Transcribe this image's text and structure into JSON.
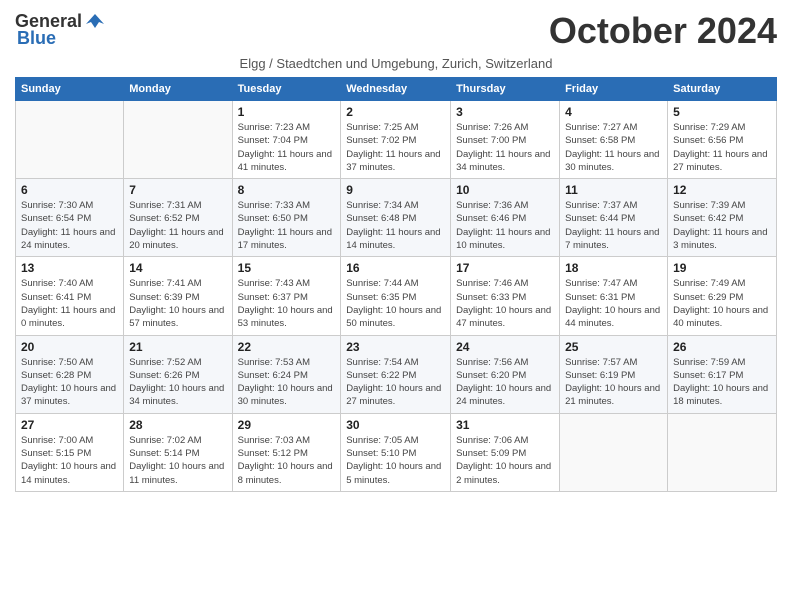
{
  "header": {
    "logo_general": "General",
    "logo_blue": "Blue",
    "month_title": "October 2024",
    "subtitle": "Elgg / Staedtchen und Umgebung, Zurich, Switzerland"
  },
  "weekdays": [
    "Sunday",
    "Monday",
    "Tuesday",
    "Wednesday",
    "Thursday",
    "Friday",
    "Saturday"
  ],
  "weeks": [
    [
      {
        "day": "",
        "info": ""
      },
      {
        "day": "",
        "info": ""
      },
      {
        "day": "1",
        "info": "Sunrise: 7:23 AM\nSunset: 7:04 PM\nDaylight: 11 hours and 41 minutes."
      },
      {
        "day": "2",
        "info": "Sunrise: 7:25 AM\nSunset: 7:02 PM\nDaylight: 11 hours and 37 minutes."
      },
      {
        "day": "3",
        "info": "Sunrise: 7:26 AM\nSunset: 7:00 PM\nDaylight: 11 hours and 34 minutes."
      },
      {
        "day": "4",
        "info": "Sunrise: 7:27 AM\nSunset: 6:58 PM\nDaylight: 11 hours and 30 minutes."
      },
      {
        "day": "5",
        "info": "Sunrise: 7:29 AM\nSunset: 6:56 PM\nDaylight: 11 hours and 27 minutes."
      }
    ],
    [
      {
        "day": "6",
        "info": "Sunrise: 7:30 AM\nSunset: 6:54 PM\nDaylight: 11 hours and 24 minutes."
      },
      {
        "day": "7",
        "info": "Sunrise: 7:31 AM\nSunset: 6:52 PM\nDaylight: 11 hours and 20 minutes."
      },
      {
        "day": "8",
        "info": "Sunrise: 7:33 AM\nSunset: 6:50 PM\nDaylight: 11 hours and 17 minutes."
      },
      {
        "day": "9",
        "info": "Sunrise: 7:34 AM\nSunset: 6:48 PM\nDaylight: 11 hours and 14 minutes."
      },
      {
        "day": "10",
        "info": "Sunrise: 7:36 AM\nSunset: 6:46 PM\nDaylight: 11 hours and 10 minutes."
      },
      {
        "day": "11",
        "info": "Sunrise: 7:37 AM\nSunset: 6:44 PM\nDaylight: 11 hours and 7 minutes."
      },
      {
        "day": "12",
        "info": "Sunrise: 7:39 AM\nSunset: 6:42 PM\nDaylight: 11 hours and 3 minutes."
      }
    ],
    [
      {
        "day": "13",
        "info": "Sunrise: 7:40 AM\nSunset: 6:41 PM\nDaylight: 11 hours and 0 minutes."
      },
      {
        "day": "14",
        "info": "Sunrise: 7:41 AM\nSunset: 6:39 PM\nDaylight: 10 hours and 57 minutes."
      },
      {
        "day": "15",
        "info": "Sunrise: 7:43 AM\nSunset: 6:37 PM\nDaylight: 10 hours and 53 minutes."
      },
      {
        "day": "16",
        "info": "Sunrise: 7:44 AM\nSunset: 6:35 PM\nDaylight: 10 hours and 50 minutes."
      },
      {
        "day": "17",
        "info": "Sunrise: 7:46 AM\nSunset: 6:33 PM\nDaylight: 10 hours and 47 minutes."
      },
      {
        "day": "18",
        "info": "Sunrise: 7:47 AM\nSunset: 6:31 PM\nDaylight: 10 hours and 44 minutes."
      },
      {
        "day": "19",
        "info": "Sunrise: 7:49 AM\nSunset: 6:29 PM\nDaylight: 10 hours and 40 minutes."
      }
    ],
    [
      {
        "day": "20",
        "info": "Sunrise: 7:50 AM\nSunset: 6:28 PM\nDaylight: 10 hours and 37 minutes."
      },
      {
        "day": "21",
        "info": "Sunrise: 7:52 AM\nSunset: 6:26 PM\nDaylight: 10 hours and 34 minutes."
      },
      {
        "day": "22",
        "info": "Sunrise: 7:53 AM\nSunset: 6:24 PM\nDaylight: 10 hours and 30 minutes."
      },
      {
        "day": "23",
        "info": "Sunrise: 7:54 AM\nSunset: 6:22 PM\nDaylight: 10 hours and 27 minutes."
      },
      {
        "day": "24",
        "info": "Sunrise: 7:56 AM\nSunset: 6:20 PM\nDaylight: 10 hours and 24 minutes."
      },
      {
        "day": "25",
        "info": "Sunrise: 7:57 AM\nSunset: 6:19 PM\nDaylight: 10 hours and 21 minutes."
      },
      {
        "day": "26",
        "info": "Sunrise: 7:59 AM\nSunset: 6:17 PM\nDaylight: 10 hours and 18 minutes."
      }
    ],
    [
      {
        "day": "27",
        "info": "Sunrise: 7:00 AM\nSunset: 5:15 PM\nDaylight: 10 hours and 14 minutes."
      },
      {
        "day": "28",
        "info": "Sunrise: 7:02 AM\nSunset: 5:14 PM\nDaylight: 10 hours and 11 minutes."
      },
      {
        "day": "29",
        "info": "Sunrise: 7:03 AM\nSunset: 5:12 PM\nDaylight: 10 hours and 8 minutes."
      },
      {
        "day": "30",
        "info": "Sunrise: 7:05 AM\nSunset: 5:10 PM\nDaylight: 10 hours and 5 minutes."
      },
      {
        "day": "31",
        "info": "Sunrise: 7:06 AM\nSunset: 5:09 PM\nDaylight: 10 hours and 2 minutes."
      },
      {
        "day": "",
        "info": ""
      },
      {
        "day": "",
        "info": ""
      }
    ]
  ]
}
